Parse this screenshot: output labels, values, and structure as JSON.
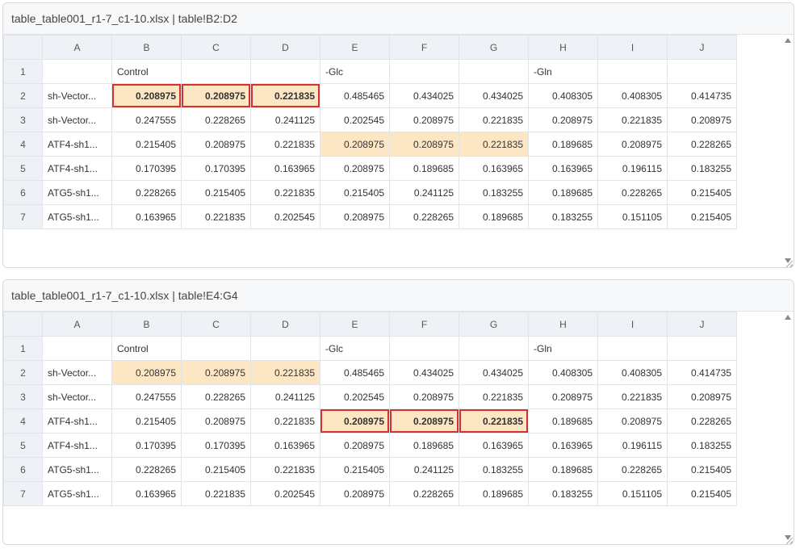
{
  "columns": [
    "A",
    "B",
    "C",
    "D",
    "E",
    "F",
    "G",
    "H",
    "I",
    "J"
  ],
  "rows": [
    {
      "num": "1",
      "cells": [
        "",
        "Control",
        "",
        "",
        "-Glc",
        "",
        "",
        "-Gln",
        "",
        ""
      ]
    },
    {
      "num": "2",
      "cells": [
        "sh-Vector...",
        "0.208975",
        "0.208975",
        "0.221835",
        "0.485465",
        "0.434025",
        "0.434025",
        "0.408305",
        "0.408305",
        "0.414735"
      ]
    },
    {
      "num": "3",
      "cells": [
        "sh-Vector...",
        "0.247555",
        "0.228265",
        "0.241125",
        "0.202545",
        "0.208975",
        "0.221835",
        "0.208975",
        "0.221835",
        "0.208975"
      ]
    },
    {
      "num": "4",
      "cells": [
        "ATF4-sh1...",
        "0.215405",
        "0.208975",
        "0.221835",
        "0.208975",
        "0.208975",
        "0.221835",
        "0.189685",
        "0.208975",
        "0.228265"
      ]
    },
    {
      "num": "5",
      "cells": [
        "ATF4-sh1...",
        "0.170395",
        "0.170395",
        "0.163965",
        "0.208975",
        "0.189685",
        "0.163965",
        "0.163965",
        "0.196115",
        "0.183255"
      ]
    },
    {
      "num": "6",
      "cells": [
        "ATG5-sh1...",
        "0.228265",
        "0.215405",
        "0.221835",
        "0.215405",
        "0.241125",
        "0.183255",
        "0.189685",
        "0.228265",
        "0.215405"
      ]
    },
    {
      "num": "7",
      "cells": [
        "ATG5-sh1...",
        "0.163965",
        "0.221835",
        "0.202545",
        "0.208975",
        "0.228265",
        "0.189685",
        "0.183255",
        "0.151105",
        "0.215405"
      ]
    }
  ],
  "highlight_ranges": [
    {
      "row": 1,
      "cols": [
        1,
        2,
        3
      ]
    },
    {
      "row": 3,
      "cols": [
        4,
        5,
        6
      ]
    }
  ],
  "colors": {
    "highlight": "#fde6c4",
    "selection_border": "#d9302c",
    "header_bg": "#eef2f7"
  },
  "panels": [
    {
      "title": "table_table001_r1-7_c1-10.xlsx | table!B2:D2",
      "selected": {
        "row": 1,
        "cols": [
          1,
          2,
          3
        ]
      }
    },
    {
      "title": "table_table001_r1-7_c1-10.xlsx | table!E4:G4",
      "selected": {
        "row": 3,
        "cols": [
          4,
          5,
          6
        ]
      }
    }
  ]
}
